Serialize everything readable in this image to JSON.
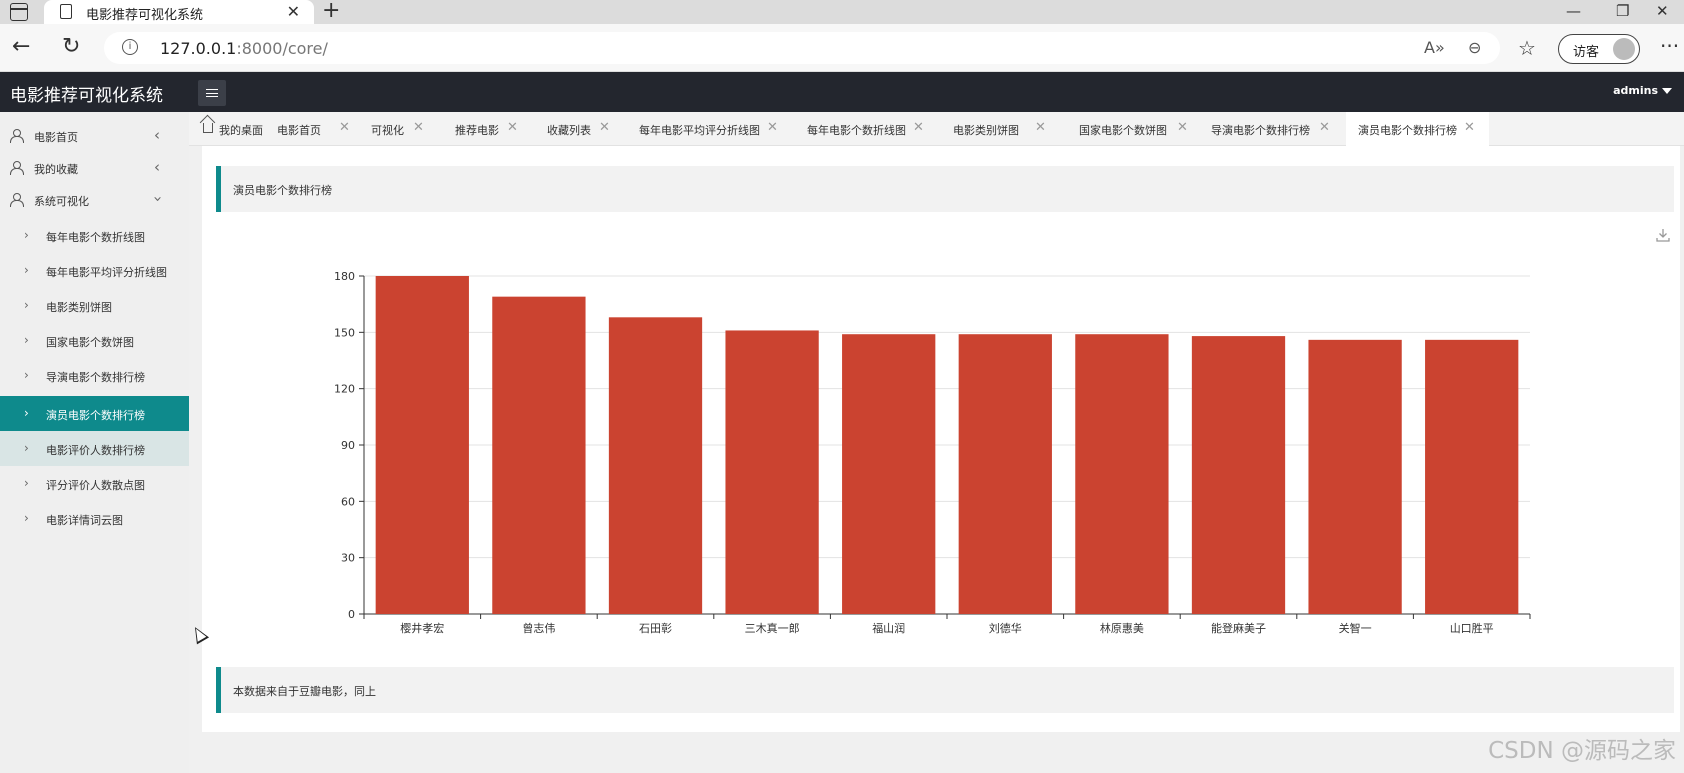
{
  "browser": {
    "tab_title": "电影推荐可视化系统",
    "url_host": "127.0.0.1",
    "url_rest": ":8000/core/",
    "guest_label": "访客"
  },
  "app": {
    "title": "电影推荐可视化系统",
    "user": "admins"
  },
  "sidebar": {
    "items": [
      {
        "label": "电影首页"
      },
      {
        "label": "我的收藏"
      },
      {
        "label": "系统可视化"
      }
    ],
    "sub_items": [
      {
        "label": "每年电影个数折线图"
      },
      {
        "label": "每年电影平均评分折线图"
      },
      {
        "label": "电影类别饼图"
      },
      {
        "label": "国家电影个数饼图"
      },
      {
        "label": "导演电影个数排行榜"
      },
      {
        "label": "演员电影个数排行榜"
      },
      {
        "label": "电影评价人数排行榜"
      },
      {
        "label": "评分评价人数散点图"
      },
      {
        "label": "电影详情词云图"
      }
    ]
  },
  "page_tabs": [
    {
      "label": "我的桌面"
    },
    {
      "label": "电影首页"
    },
    {
      "label": "可视化"
    },
    {
      "label": "推荐电影"
    },
    {
      "label": "收藏列表"
    },
    {
      "label": "每年电影平均评分折线图"
    },
    {
      "label": "每年电影个数折线图"
    },
    {
      "label": "电影类别饼图"
    },
    {
      "label": "国家电影个数饼图"
    },
    {
      "label": "导演电影个数排行榜"
    },
    {
      "label": "演员电影个数排行榜"
    }
  ],
  "content": {
    "heading": "演员电影个数排行榜",
    "footer_note": "本数据来自于豆瓣电影，同上"
  },
  "chart_data": {
    "type": "bar",
    "categories": [
      "樱井孝宏",
      "曾志伟",
      "石田彰",
      "三木真一郎",
      "福山润",
      "刘德华",
      "林原惠美",
      "能登麻美子",
      "关智一",
      "山口胜平"
    ],
    "values": [
      180,
      169,
      158,
      151,
      149,
      149,
      149,
      148,
      146,
      146
    ],
    "yticks": [
      "0",
      "30",
      "60",
      "90",
      "120",
      "150",
      "180"
    ],
    "ylim": [
      0,
      180
    ],
    "bar_color": "#cb4330"
  },
  "watermark": "CSDN @源码之家",
  "colors": {
    "accent": "#0e8a8c",
    "header_bg": "#23262e"
  }
}
